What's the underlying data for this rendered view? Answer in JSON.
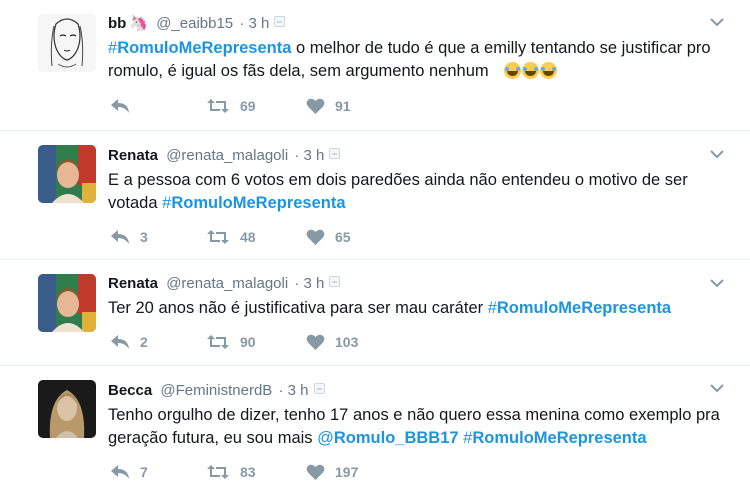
{
  "tweets": [
    {
      "name": "bb",
      "handle": "@_eaibb15",
      "time": "· 3 h",
      "text_parts": [
        "o melhor de tudo é que a emilly tentando se justificar pro romulo, é igual os fãs dela, sem argumento nenhum"
      ],
      "hashtag": "RomuloMeRepresenta",
      "emoji": "😂😂😂",
      "reply_count": "",
      "retweet_count": "69",
      "like_count": "91"
    },
    {
      "name": "Renata",
      "handle": "@renata_malagoli",
      "time": "· 3 h",
      "text": "E a pessoa com 6 votos em dois paredões ainda não entendeu o motivo de ser votada",
      "hashtag": "RomuloMeRepresenta",
      "reply_count": "3",
      "retweet_count": "48",
      "like_count": "65"
    },
    {
      "name": "Renata",
      "handle": "@renata_malagoli",
      "time": "· 3 h",
      "text": "Ter 20 anos não é justificativa para ser mau caráter",
      "hashtag": "RomuloMeRepresenta",
      "reply_count": "2",
      "retweet_count": "90",
      "like_count": "103"
    },
    {
      "name": "Becca",
      "handle": "@FeministnerdB",
      "time": "· 3 h",
      "text": "Tenho orgulho de dizer, tenho 17 anos e não quero essa menina como exemplo pra geração futura, eu sou mais",
      "mention": "Romulo_BBB17",
      "hashtag": "RomuloMeRepresenta",
      "reply_count": "7",
      "retweet_count": "83",
      "like_count": "197"
    }
  ],
  "symbols": {
    "hash": "#",
    "at": "@"
  },
  "colors": {
    "link": "#1b95e0",
    "muted": "#8899a6",
    "border": "#e6ecf0"
  },
  "icons": [
    "reply-icon",
    "retweet-icon",
    "like-icon",
    "caret-down-icon",
    "geo-icon"
  ]
}
